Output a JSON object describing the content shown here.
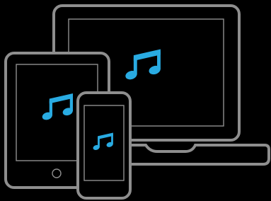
{
  "illustration": {
    "subject": "music-on-multiple-devices",
    "devices": [
      "laptop",
      "tablet",
      "phone"
    ],
    "icons": {
      "laptop_screen": "music-note-icon",
      "tablet_screen": "music-note-icon",
      "phone_screen": "music-note-icon",
      "tablet_home": "home-button-icon"
    },
    "colors": {
      "background": "#000000",
      "device_outline": "#8e8e8e",
      "music_note": "#29abe2"
    }
  }
}
